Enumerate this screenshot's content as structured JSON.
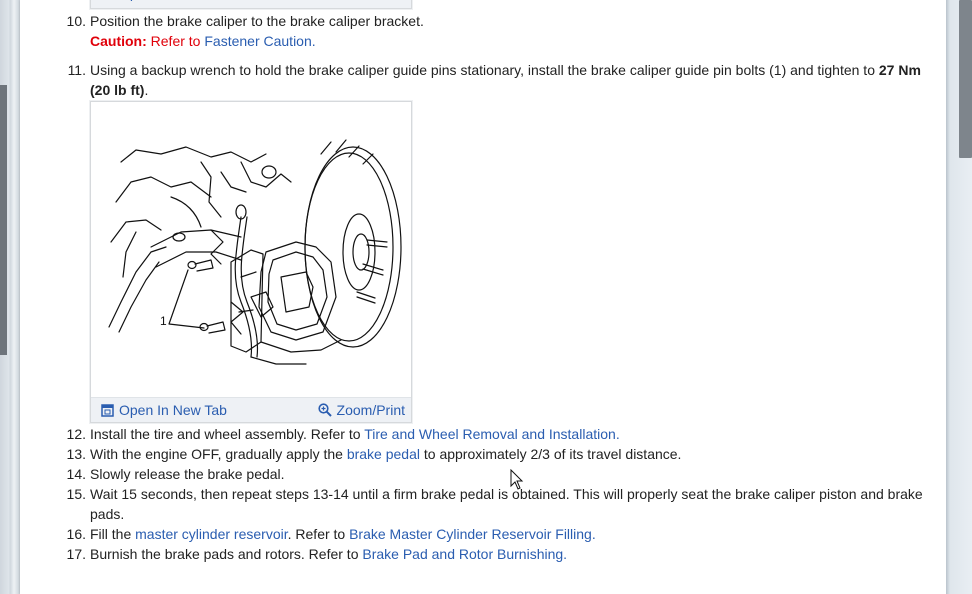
{
  "figure_toolbar": {
    "open_new_tab_label": "Open In New Tab",
    "zoom_print_label": "Zoom/Print"
  },
  "steps": [
    {
      "num": "10.",
      "text": "Position the brake caliper to the brake caliper bracket.",
      "caution_label": "Caution:",
      "caution_text": "Refer to",
      "caution_link": "Fastener Caution",
      "caution_end": "."
    },
    {
      "num": "11.",
      "text_a": "Using a backup wrench to hold the brake caliper guide pins stationary, install the brake caliper guide pin bolts (1) and tighten to ",
      "bold": "27 Nm (20 lb ft)",
      "text_b": ".",
      "figure_callout": "1"
    },
    {
      "num": "12.",
      "text_a": "Install the tire and wheel assembly. Refer to ",
      "link": "Tire and Wheel Removal and Installation",
      "text_b": "."
    },
    {
      "num": "13.",
      "text_a": "With the engine OFF, gradually apply the ",
      "link": "brake pedal",
      "text_b": " to approximately 2/3 of its travel distance."
    },
    {
      "num": "14.",
      "text": "Slowly release the brake pedal."
    },
    {
      "num": "15.",
      "text": "Wait 15 seconds, then repeat steps 13-14 until a firm brake pedal is obtained. This will properly seat the brake caliper piston and brake pads."
    },
    {
      "num": "16.",
      "text_a": "Fill the ",
      "link": "master cylinder reservoir",
      "text_b": ". Refer to ",
      "link2": "Brake Master Cylinder Reservoir Filling",
      "text_c": "."
    },
    {
      "num": "17.",
      "text_a": "Burnish the brake pads and rotors. Refer to ",
      "link": "Brake Pad and Rotor Burnishing",
      "text_b": "."
    }
  ],
  "colors": {
    "link": "#2a5db0",
    "caution": "#e0000a",
    "toolbar_bg": "#eef1f5"
  }
}
